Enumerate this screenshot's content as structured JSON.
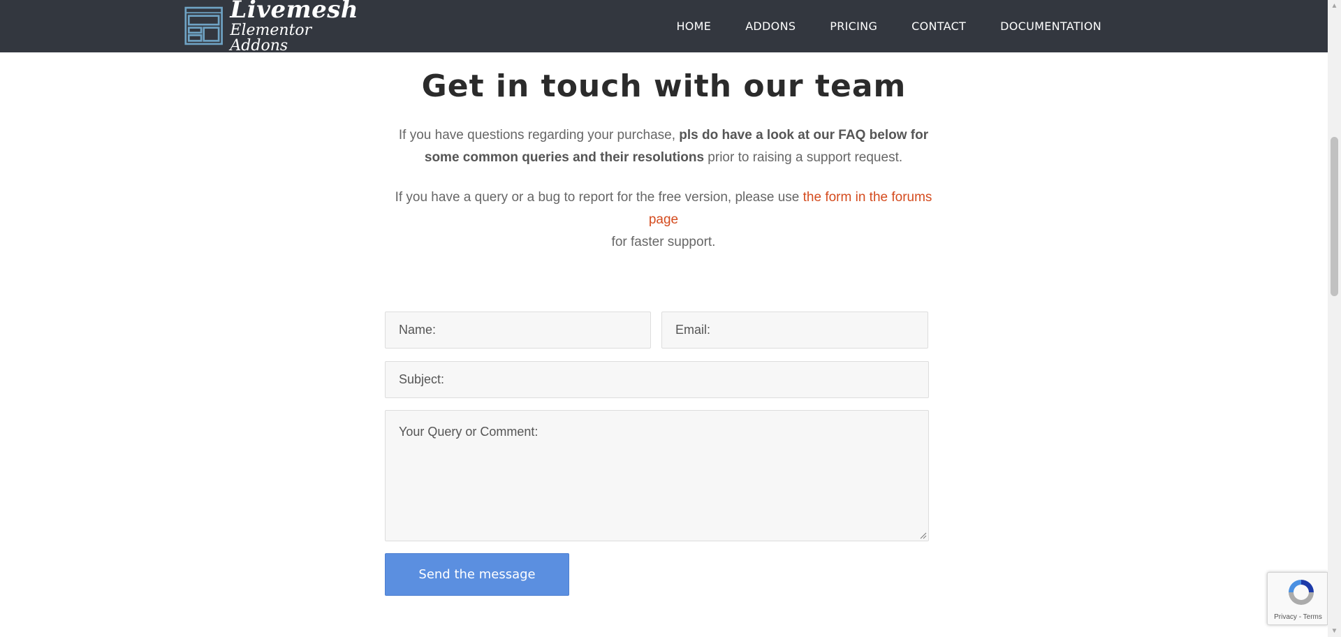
{
  "header": {
    "logo_title": "Livemesh",
    "logo_subtitle": "Elementor Addons",
    "nav": [
      {
        "label": "HOME"
      },
      {
        "label": "ADDONS"
      },
      {
        "label": "PRICING"
      },
      {
        "label": "CONTACT"
      },
      {
        "label": "DOCUMENTATION"
      }
    ]
  },
  "main": {
    "title": "Get in touch with our team",
    "para1": {
      "text1": "If you have questions regarding your purchase, ",
      "bold": "pls do have a look at our FAQ below for some common queries and their resolutions",
      "text2": " prior to raising a support request."
    },
    "para2": {
      "text1": "If you have a query or a bug to report for the free version, please use ",
      "link": "the form in the forums page",
      "text2": " for faster support."
    }
  },
  "form": {
    "name_placeholder": "Name:",
    "email_placeholder": "Email:",
    "subject_placeholder": "Subject:",
    "comment_placeholder": "Your Query or Comment:",
    "submit_label": "Send the message"
  },
  "recaptcha": {
    "privacy": "Privacy",
    "separator": " - ",
    "terms": "Terms"
  },
  "colors": {
    "header_bg": "#33373f",
    "link": "#d44b1e",
    "button": "#5b8fe0"
  }
}
